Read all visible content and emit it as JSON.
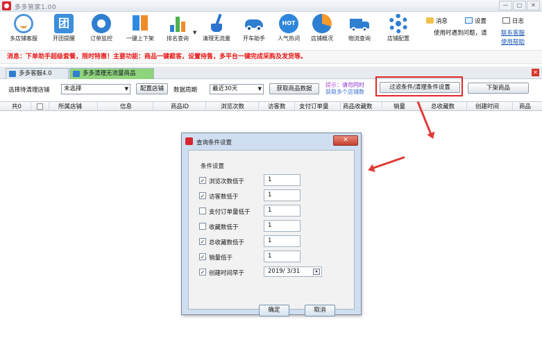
{
  "app": {
    "title": "多多管家1.00"
  },
  "window_buttons": [
    "—",
    "□",
    "✕"
  ],
  "toolbar": {
    "items": [
      {
        "label": "多店铺客服",
        "icon": "customer-service-icon"
      },
      {
        "label": "开团提醒",
        "icon": "group-buy-icon"
      },
      {
        "label": "订单监控",
        "icon": "camera-icon"
      },
      {
        "label": "一键上下架",
        "icon": "updown-icon"
      },
      {
        "label": "排名查询",
        "icon": "bar-chart-icon"
      },
      {
        "label": "清理无流量",
        "icon": "broom-icon"
      },
      {
        "label": "开车助手",
        "icon": "car-icon"
      },
      {
        "label": "人气热词",
        "icon": "hot-icon"
      },
      {
        "label": "店铺概况",
        "icon": "pie-chart-icon"
      },
      {
        "label": "物流查询",
        "icon": "truck-icon"
      },
      {
        "label": "店铺配置",
        "icon": "gear-icon"
      }
    ],
    "right": {
      "message": "消息",
      "settings": "设置",
      "log": "日志",
      "problem_text": "使用时遇到问题，请",
      "contact_link": "联系客服",
      "help_link": "使用帮助"
    }
  },
  "marquee": {
    "text": "消息：下单助手超级套餐，限时特惠！主要功能：商品一键截客，设置待售，多平台一键完成采购及发货等。"
  },
  "tabs": [
    {
      "label": "多多客服4.0",
      "active": false
    },
    {
      "label": "多多清理无流量商品",
      "active": true
    }
  ],
  "controls": {
    "store_label": "选择待清理店铺",
    "store_value": "未选择",
    "config_button": "配置店铺",
    "period_label": "数据周期",
    "period_value": "最近30天",
    "fetch_button": "获取商品数据",
    "hint_prefix": "提示：",
    "hint_line1": "请勿同时",
    "hint_line2": "获取多个店铺数",
    "filter_button": "过滤条件/清理条件设置",
    "remove_button": "下架商品"
  },
  "grid": {
    "columns": [
      "共0",
      "所属店铺",
      "信息",
      "商品ID",
      "浏览次数",
      "访客数",
      "支付订单量",
      "商品收藏数",
      "销量",
      "总收藏数",
      "创建时间",
      "商品"
    ]
  },
  "dialog": {
    "title": "查询条件设置",
    "group_label": "条件设置",
    "conditions": [
      {
        "label": "浏览次数低于",
        "checked": true,
        "value": "1"
      },
      {
        "label": "访客数低于",
        "checked": true,
        "value": "1"
      },
      {
        "label": "支付订单量低于",
        "checked": false,
        "value": "1"
      },
      {
        "label": "收藏数低于",
        "checked": false,
        "value": "1"
      },
      {
        "label": "总收藏数低于",
        "checked": true,
        "value": "1"
      },
      {
        "label": "销量低于",
        "checked": true,
        "value": "1"
      },
      {
        "label": "创建时间早于",
        "checked": true,
        "value": "2019/ 3/31"
      }
    ],
    "ok_button": "确定",
    "cancel_button": "取消",
    "close_glyph": "✕"
  },
  "colors": {
    "accent": "#2f7fd1",
    "alert": "#e81919",
    "tab_active": "#8fd47c",
    "annotation_red": "#e02525"
  }
}
